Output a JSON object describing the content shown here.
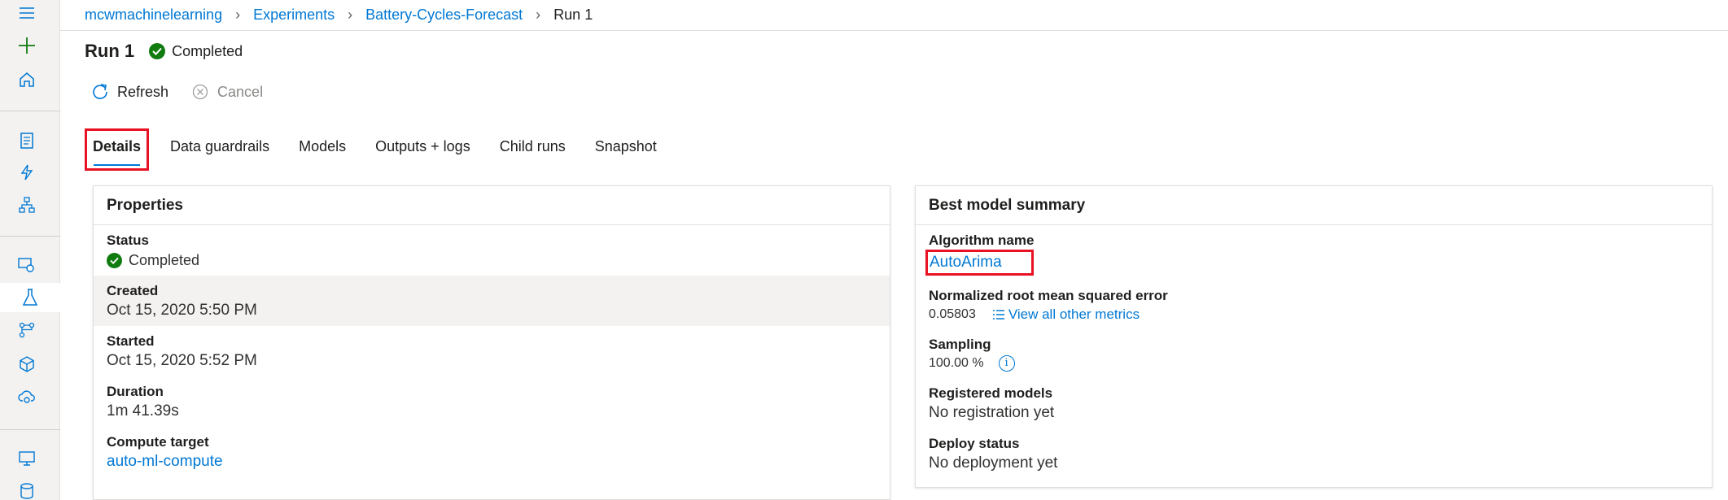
{
  "rail": {
    "icons": [
      "hamburger-icon",
      "plus-icon",
      "home-icon",
      "notebook-icon",
      "automl-icon",
      "designer-icon",
      "datasets-icon",
      "experiments-icon",
      "pipelines-icon",
      "models-icon",
      "endpoints-icon",
      "compute-icon",
      "datastores-icon"
    ]
  },
  "breadcrumb": {
    "workspace": "mcwmachinelearning",
    "experiments": "Experiments",
    "experiment": "Battery-Cycles-Forecast",
    "run": "Run 1"
  },
  "header": {
    "title": "Run 1",
    "status": "Completed"
  },
  "toolbar": {
    "refresh_label": "Refresh",
    "cancel_label": "Cancel"
  },
  "tabs": [
    {
      "label": "Details"
    },
    {
      "label": "Data guardrails"
    },
    {
      "label": "Models"
    },
    {
      "label": "Outputs + logs"
    },
    {
      "label": "Child runs"
    },
    {
      "label": "Snapshot"
    }
  ],
  "properties": {
    "title": "Properties",
    "status_label": "Status",
    "status_value": "Completed",
    "created_label": "Created",
    "created_value": "Oct 15, 2020 5:50 PM",
    "started_label": "Started",
    "started_value": "Oct 15, 2020 5:52 PM",
    "duration_label": "Duration",
    "duration_value": "1m 41.39s",
    "compute_label": "Compute target",
    "compute_value": "auto-ml-compute"
  },
  "summary": {
    "title": "Best model summary",
    "algorithm_label": "Algorithm name",
    "algorithm_value": "AutoArima",
    "nrmse_label": "Normalized root mean squared error",
    "nrmse_value": "0.05803",
    "metrics_link": "View all other metrics",
    "sampling_label": "Sampling",
    "sampling_value": "100.00 %",
    "registered_label": "Registered models",
    "registered_value": "No registration yet",
    "deploy_label": "Deploy status",
    "deploy_value": "No deployment yet"
  },
  "colors": {
    "accent": "#0078d4",
    "success": "#107c10",
    "highlight": "#e81123"
  }
}
